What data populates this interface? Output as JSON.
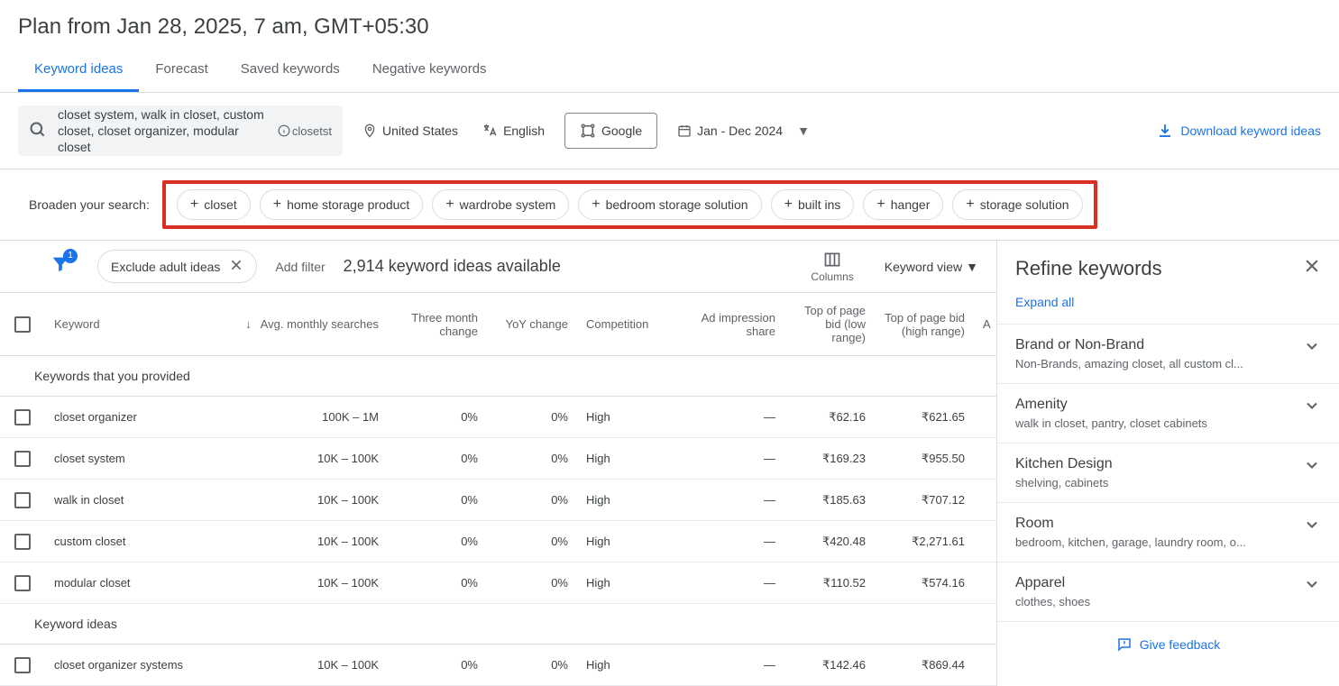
{
  "page_title": "Plan from Jan 28, 2025, 7 am, GMT+05:30",
  "tabs": [
    "Keyword ideas",
    "Forecast",
    "Saved keywords",
    "Negative keywords"
  ],
  "active_tab": 0,
  "search": {
    "keywords_text": "closet system, walk in closet, custom closet, closet organizer, modular closet",
    "site_label": "closetst"
  },
  "filters": {
    "location": "United States",
    "language": "English",
    "network": "Google",
    "date_range": "Jan - Dec 2024"
  },
  "download_label": "Download keyword ideas",
  "broaden": {
    "label": "Broaden your search:",
    "chips": [
      "closet",
      "home storage product",
      "wardrobe system",
      "bedroom storage solution",
      "built ins",
      "hanger",
      "storage solution"
    ]
  },
  "toolbar": {
    "filter_badge": "1",
    "exclude_pill": "Exclude adult ideas",
    "add_filter": "Add filter",
    "ideas_count": "2,914 keyword ideas available",
    "columns_label": "Columns",
    "keyword_view": "Keyword view"
  },
  "columns": {
    "keyword": "Keyword",
    "searches": "Avg. monthly searches",
    "three_month": "Three month change",
    "yoy": "YoY change",
    "competition": "Competition",
    "impression": "Ad impression share",
    "bid_low": "Top of page bid (low range)",
    "bid_high": "Top of page bid (high range)",
    "extra": "A"
  },
  "groups": {
    "provided": "Keywords that you provided",
    "ideas": "Keyword ideas"
  },
  "rows_provided": [
    {
      "kw": "closet organizer",
      "searches": "100K – 1M",
      "tm": "0%",
      "yoy": "0%",
      "comp": "High",
      "impr": "—",
      "low": "₹62.16",
      "high": "₹621.65"
    },
    {
      "kw": "closet system",
      "searches": "10K – 100K",
      "tm": "0%",
      "yoy": "0%",
      "comp": "High",
      "impr": "—",
      "low": "₹169.23",
      "high": "₹955.50"
    },
    {
      "kw": "walk in closet",
      "searches": "10K – 100K",
      "tm": "0%",
      "yoy": "0%",
      "comp": "High",
      "impr": "—",
      "low": "₹185.63",
      "high": "₹707.12"
    },
    {
      "kw": "custom closet",
      "searches": "10K – 100K",
      "tm": "0%",
      "yoy": "0%",
      "comp": "High",
      "impr": "—",
      "low": "₹420.48",
      "high": "₹2,271.61"
    },
    {
      "kw": "modular closet",
      "searches": "10K – 100K",
      "tm": "0%",
      "yoy": "0%",
      "comp": "High",
      "impr": "—",
      "low": "₹110.52",
      "high": "₹574.16"
    }
  ],
  "rows_ideas": [
    {
      "kw": "closet organizer systems",
      "searches": "10K – 100K",
      "tm": "0%",
      "yoy": "0%",
      "comp": "High",
      "impr": "—",
      "low": "₹142.46",
      "high": "₹869.44"
    }
  ],
  "refine": {
    "title": "Refine keywords",
    "expand_all": "Expand all",
    "groups": [
      {
        "title": "Brand or Non-Brand",
        "sub": "Non-Brands, amazing closet, all custom cl..."
      },
      {
        "title": "Amenity",
        "sub": "walk in closet, pantry, closet cabinets"
      },
      {
        "title": "Kitchen Design",
        "sub": "shelving, cabinets"
      },
      {
        "title": "Room",
        "sub": "bedroom, kitchen, garage, laundry room, o..."
      },
      {
        "title": "Apparel",
        "sub": "clothes, shoes"
      }
    ],
    "feedback": "Give feedback"
  }
}
